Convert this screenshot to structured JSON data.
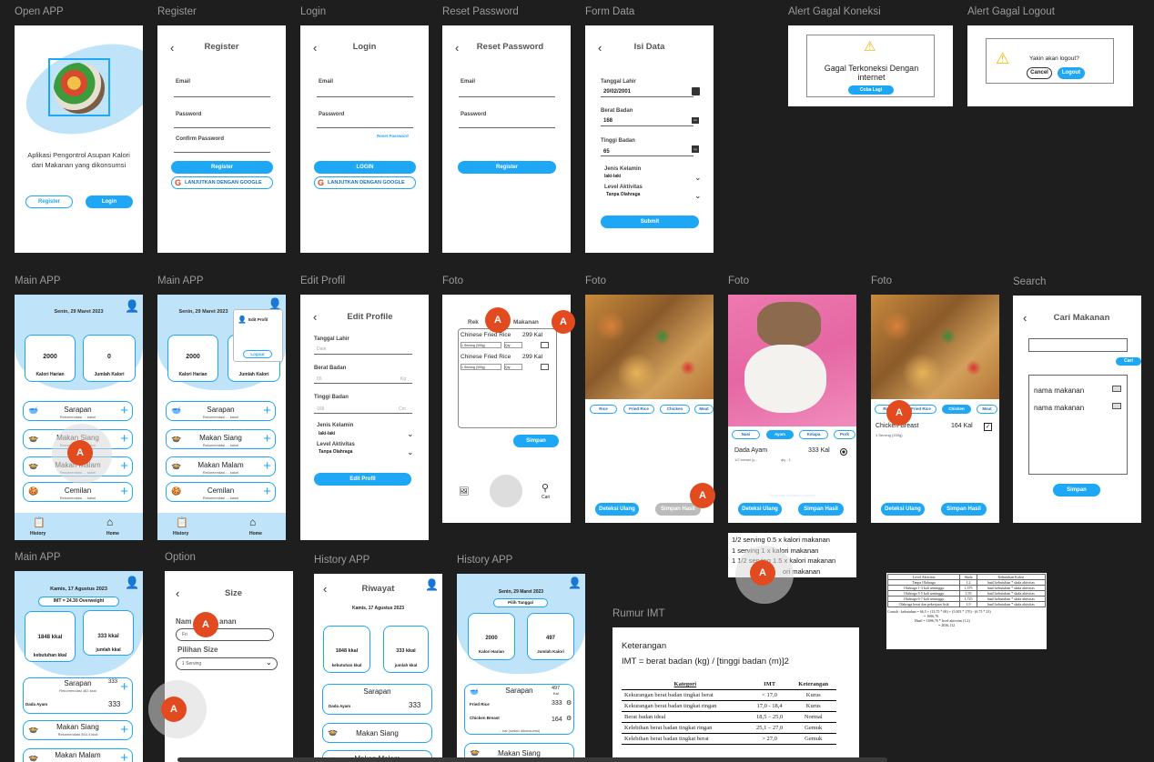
{
  "frames": {
    "open_app": "Open APP",
    "register": "Register",
    "login": "Login",
    "reset": "Reset Password",
    "form": "Form Data",
    "alert_conn": "Alert Gagal Koneksi",
    "alert_logout": "Alert Gagal Logout",
    "main1": "Main APP",
    "main2": "Main APP",
    "edit": "Edit Profil",
    "foto1": "Foto",
    "foto2": "Foto",
    "foto3": "Foto",
    "foto4": "Foto",
    "search": "Search",
    "main3": "Main APP",
    "option": "Option",
    "hist1": "History APP",
    "hist2": "History APP",
    "rumus": "Rumur IMT"
  },
  "open_app": {
    "tagline": "Aplikasi Pengontrol Asupan Kalori dari Makanan yang dikonsumsi",
    "register": "Register",
    "login": "Login"
  },
  "register": {
    "title": "Register",
    "email": "Email",
    "password": "Password",
    "confirm": "Confirm Password",
    "btn": "Register",
    "google": "LANJUTKAN DENGAN GOOGLE"
  },
  "login": {
    "title": "Login",
    "email": "Email",
    "password": "Password",
    "reset": "Reset Password",
    "btn": "LOGIN",
    "google": "LANJUTKAN DENGAN GOOGLE"
  },
  "reset": {
    "title": "Reset Password",
    "email": "Email",
    "password": "Password",
    "btn": "Register"
  },
  "form": {
    "title": "Isi Data",
    "dob_label": "Tanggal Lahir",
    "dob": "20/02/2001",
    "bb_label": "Berat Badan",
    "bb": "168",
    "bb_unit": "cm",
    "tb_label": "Tinggi Badan",
    "tb": "65",
    "tb_unit": "kg",
    "jk_label": "Jenis Kelamin",
    "jk": "laki-laki",
    "lvl_label": "Level Aktivitas",
    "lvl": "Tanpa Olahraga",
    "btn": "Submit"
  },
  "alert_conn": {
    "text": "Gagal Terkoneksi Dengan internet",
    "btn": "Coba Lagi"
  },
  "alert_logout": {
    "text": "Yakin akan logout?",
    "cancel": "Cancel",
    "logout": "Logout"
  },
  "main1": {
    "date": "Senin, 29 Maret 2023",
    "kal": "2000",
    "kal_label": "Kalori Harian",
    "jml": "0",
    "jml_label": "Jumlah Kalori",
    "meals": [
      "Sarapan",
      "Makan Siang",
      "Makan Malam",
      "Cemilan"
    ],
    "meal_sub": "Rekomendasi ... kalori",
    "nav_history": "History",
    "nav_home": "Home"
  },
  "main2": {
    "date": "Senin, 29 Maret 2023",
    "kal": "2000",
    "kal_label": "Kalori Harian",
    "jml_label": "Jumlah Kalori",
    "menu_edit": "Edit Profil",
    "menu_logout": "Logout",
    "meals": [
      "Sarapan",
      "Makan Siang",
      "Makan Malam",
      "Cemilan"
    ],
    "meal_sub": "Rekomendasi ... kalori",
    "nav_history": "History",
    "nav_home": "Home"
  },
  "edit": {
    "title": "Edit Profile",
    "dob_label": "Tanggal Lahir",
    "dob_ph": "Date",
    "bb_label": "Berat Badan",
    "bb": "65",
    "bb_unit": "Kg",
    "tb_label": "Tinggi Badan",
    "tb": "168",
    "tb_unit": "Cm",
    "jk_label": "Jenis Kelamin",
    "jk": "laki-laki",
    "lvl_label": "Level Aktivitas",
    "lvl": "Tanpa Olahraga",
    "btn": "Edit Profil"
  },
  "foto1": {
    "title_a": "Rek",
    "title_b": "Makanan",
    "items": [
      {
        "name": "Chinese Fried Rice",
        "kal": "299 Kal",
        "serving": "1 Serving (300g)",
        "qty": "Qty"
      },
      {
        "name": "Chinese Fried Rice",
        "kal": "299 Kal",
        "serving": "1 Serving (300g)",
        "qty": "Qty"
      }
    ],
    "simpan": "Simpan",
    "cari": "Cari"
  },
  "foto2": {
    "chips": [
      "Rice",
      "Fried Rice",
      "Chicken",
      "Meat"
    ],
    "deteksi": "Deteksi Ulang",
    "simpan": "Simpan Hasil"
  },
  "foto3": {
    "chips": [
      "Nasi",
      "Ayam",
      "Kelapa",
      "Pork"
    ],
    "item": "Dada Ayam",
    "kal": "333 Kal",
    "serving": "1/2 breast (y...",
    "qty": "qty : 1",
    "faded": "Tampilkan Makanan Lainnya",
    "deteksi": "Deteksi Ulang",
    "simpan": "Simpan Hasil",
    "note": [
      "1/2 serving 0.5 x kalori makanan",
      "1 serving 1 x kalori makanan",
      "1 1/2 serving 1.5 x kalori makanan",
      "ori makanan"
    ]
  },
  "foto4": {
    "chips": [
      "Rice",
      "Fried Rice",
      "Chicken",
      "Meat"
    ],
    "item": "Chicken Breast",
    "kal": "164 Kal",
    "serving": "1 Serving (100g)",
    "deteksi": "Deteksi Ulang",
    "simpan": "Simpan Hasil"
  },
  "search": {
    "title": "Cari Makanan",
    "btn": "Cari",
    "items": [
      "nama makanan",
      "nama makanan"
    ],
    "simpan": "Simpan"
  },
  "main3": {
    "date": "Kamis, 17 Agustus 2023",
    "imt": "IMT = 24.30 Overweight",
    "kal": "1848 kkal",
    "kal_label": "kebutuhan kkal",
    "jml": "333 kkal",
    "jml_label": "jumlah kkal",
    "sarapan": "Sarapan",
    "sarapan_val": "333",
    "sarapan_sub": "Rekomendasi 462 kkal",
    "food": "Dada Ayam",
    "food_val": "333",
    "siang": "Makan Siang",
    "siang_sub": "Rekomendasi 554.4 kkal",
    "malam": "Makan Malam"
  },
  "option": {
    "title": "Size",
    "nama_label": "Nam",
    "nama_label2": "anan",
    "nama_val": "Fri",
    "size_label": "Pilihan Size",
    "size_val": "1 Serving"
  },
  "hist1": {
    "title": "Riwayat",
    "date": "Kamis, 17 Agustus 2023",
    "kal": "1848 kkal",
    "kal_label": "kebutuhan kkal",
    "jml": "333 kkal",
    "jml_label": "jumlah kkal",
    "sarapan": "Sarapan",
    "food": "Dada Ayam",
    "food_val": "333",
    "siang": "Makan Siang",
    "malam": "Makan Malam"
  },
  "hist2": {
    "date": "Senin, 29 Maret 2023",
    "pilih": "Pilih Tanggal",
    "kal": "2000",
    "kal_label": "Kalori Harian",
    "jml": "497",
    "jml_label": "Jumlah Kalori",
    "sarapan": "Sarapan",
    "sarapan_val": "497",
    "sarapan_unit": "Kal",
    "f1": "Fried Rice",
    "f1v": "333",
    "f2": "Chicken Breast",
    "f2v": "164",
    "sub": "... kal (sudah dikonsumsi)",
    "siang": "Makan Siang"
  },
  "rumus": {
    "ket": "Keterangan",
    "formula": "IMT = berat badan (kg) / [tinggi badan (m)]2",
    "headers": [
      "Kategori",
      "IMT",
      "Keterangan"
    ],
    "rows": [
      [
        "Kekurangan berat badan tingkat berat",
        "< 17,0",
        "Kurus"
      ],
      [
        "Kekurangan berat badan tingkat ringan",
        "17,0 - 18,4",
        "Kurus"
      ],
      [
        "Berat badan ideal",
        "18,5 – 25,0",
        "Normal"
      ],
      [
        "Kelebihan berat badan tingkat ringan",
        "25,1 – 27,0",
        "Gemuk"
      ],
      [
        "Kelebihan berat badan tingkat berat",
        "> 27,0",
        "Gemuk"
      ]
    ]
  },
  "activity": {
    "headers": [
      "Level Aktivitas",
      "Skala",
      "Kebutuhan Kalori"
    ],
    "rows": [
      [
        "Tanpa Olahraga",
        "1,2",
        "hasil kebutuhan * skala aktivitas"
      ],
      [
        "Olahraga 1-3 kali seminggu",
        "1,375",
        "hasil kebutuhan * skala aktivitas"
      ],
      [
        "Olahraga 3-5 kali seminggu",
        "1,55",
        "hasil kebutuhan * skala aktivitas"
      ],
      [
        "Olahraga 6-7 kali seminggu",
        "1,725",
        "hasil kebutuhan * skala aktivitas"
      ],
      [
        "Olahraga berat dan pekerjaan fisik",
        "1,9",
        "hasil kebutuhan * skala aktivitas"
      ]
    ],
    "notes": [
      "Contoh : kebutuhan = 66,5 + (13,75 * 68) + (5.003 * 170) - (6.75 * 23)",
      "= 1696,76",
      "Hasil = 1696,76 * level aktivitas (1,2)",
      "= 2036,112"
    ]
  },
  "colors": {
    "accent": "#1ea7f5",
    "fab": "#e24a1f",
    "canvas": "#1e1e1e"
  }
}
